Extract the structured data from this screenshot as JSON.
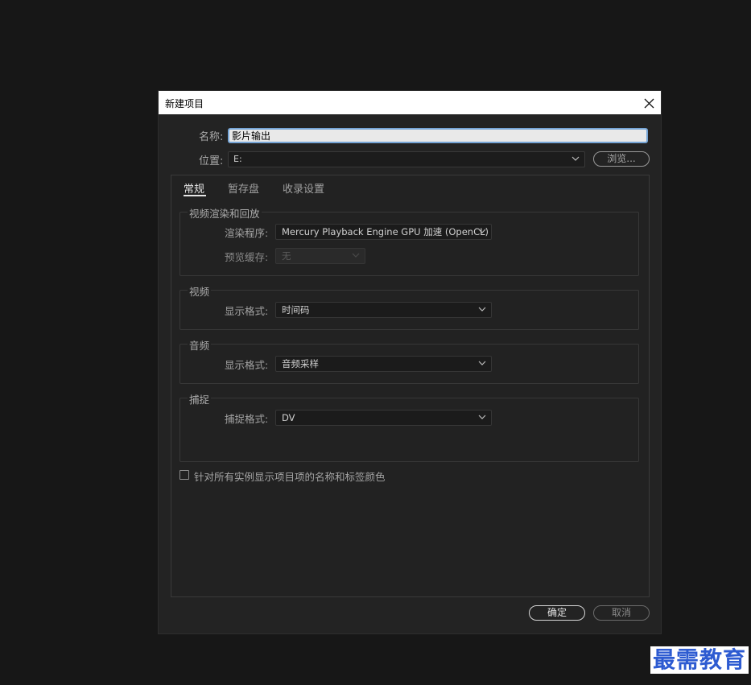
{
  "dialog": {
    "title": "新建项目",
    "name_label": "名称:",
    "name_value": "影片输出",
    "location_label": "位置:",
    "location_value": "E:",
    "browse_label": "浏览...",
    "tabs": [
      {
        "label": "常规",
        "active": true
      },
      {
        "label": "暂存盘",
        "active": false
      },
      {
        "label": "收录设置",
        "active": false
      }
    ],
    "groups": {
      "render": {
        "title": "视频渲染和回放",
        "renderer_label": "渲染程序:",
        "renderer_value": "Mercury Playback Engine GPU 加速 (OpenCL)",
        "preview_cache_label": "预览缓存:",
        "preview_cache_value": "无"
      },
      "video": {
        "title": "视频",
        "display_format_label": "显示格式:",
        "display_format_value": "时间码"
      },
      "audio": {
        "title": "音频",
        "display_format_label": "显示格式:",
        "display_format_value": "音频采样"
      },
      "capture": {
        "title": "捕捉",
        "capture_format_label": "捕捉格式:",
        "capture_format_value": "DV"
      }
    },
    "checkbox_label": "针对所有实例显示项目项的名称和标签颜色",
    "checkbox_checked": false,
    "ok_label": "确定",
    "cancel_label": "取消"
  },
  "watermark": "最需教育"
}
